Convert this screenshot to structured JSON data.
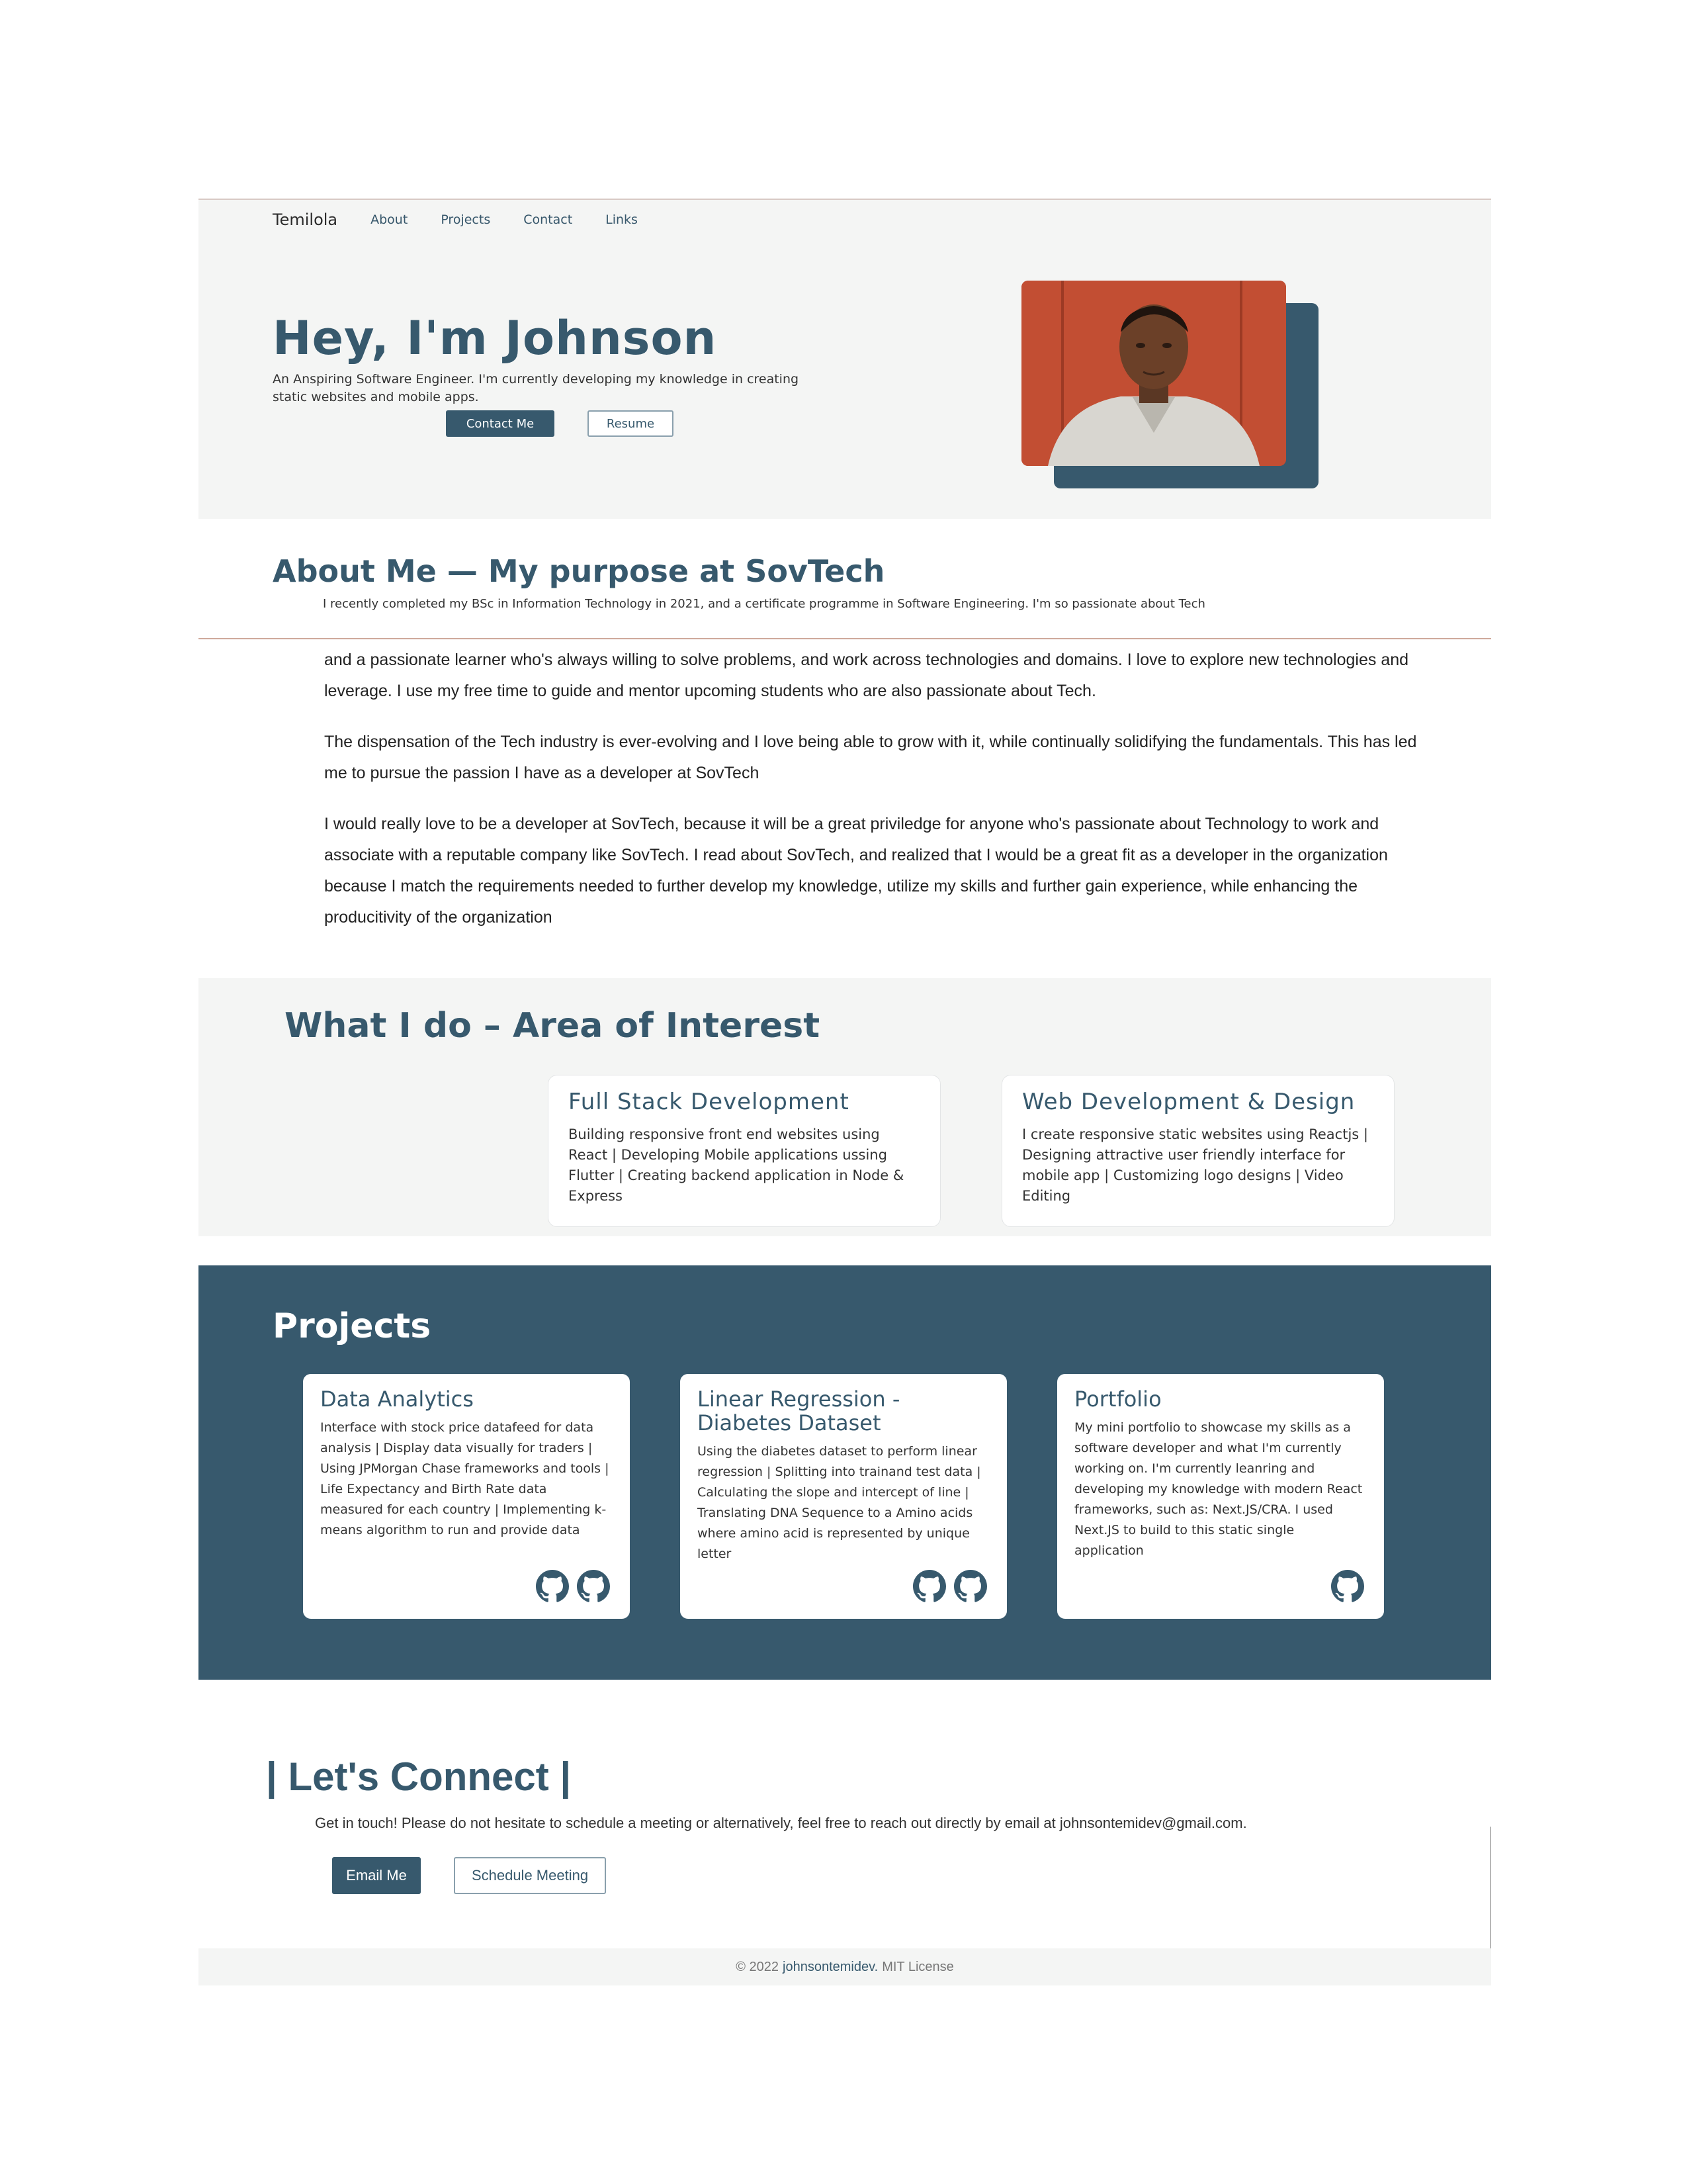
{
  "nav": {
    "brand": "Temilola",
    "links": [
      "About",
      "Projects",
      "Contact",
      "Links"
    ]
  },
  "hero": {
    "title": "Hey, I'm Johnson",
    "tagline": "An Anspiring Software Engineer. I'm currently developing my knowledge in creating static websites and mobile apps.",
    "contact_button": "Contact Me",
    "resume_button": "Resume"
  },
  "about": {
    "title": "About Me — My purpose at SovTech",
    "first_line": "I recently completed my BSc in Information Technology in 2021, and a certificate programme in Software Engineering. I'm so passionate about Tech",
    "paragraphs": [
      "and a passionate learner who's always willing to solve problems, and work across technologies and domains. I love to explore new technologies and leverage. I use my free time to guide and mentor upcoming students who are also passionate about Tech.",
      "The dispensation of the Tech industry is ever-evolving and I love being able to grow with it, while continually solidifying the fundamentals. This has led me to pursue the passion I have as a developer at SovTech",
      "I would really love to be a developer at SovTech, because it will be a great priviledge for anyone who's passionate about Technology to work and associate with a reputable company like SovTech. I read about SovTech, and realized that I would be a great fit as a developer in the organization because I match the requirements needed to further develop my knowledge, utilize my skills and further gain experience, while enhancing the producitivity of the organization"
    ]
  },
  "interest": {
    "title": "What I do – Area of Interest",
    "cards": [
      {
        "title": "Full Stack Development",
        "text": "Building responsive front end websites using React | Developing Mobile applications ussing Flutter | Creating backend application in Node & Express"
      },
      {
        "title": "Web Development & Design",
        "text": "I create responsive static websites using Reactjs | Designing attractive user friendly interface for mobile app | Customizing logo designs | Video Editing"
      }
    ]
  },
  "projects": {
    "title": "Projects",
    "cards": [
      {
        "title": "Data Analytics",
        "text": "Interface with stock price datafeed for data analysis | Display data visually for traders | Using JPMorgan Chase frameworks and tools | Life Expectancy and Birth Rate data measured for each country | Implementing k-means algorithm to run and provide data"
      },
      {
        "title": "Linear Regression - Diabetes Dataset",
        "text": "Using the diabetes dataset to perform linear regression | Splitting into trainand test data | Calculating the slope and intercept of line | Translating DNA Sequence to a Amino acids where amino acid is represented by unique letter"
      },
      {
        "title": "Portfolio",
        "text": "My mini portfolio to showcase my skills as a software developer and what I'm currently working on. I'm currently leanring and developing my knowledge with modern React frameworks, such as: Next.JS/CRA. I used Next.JS to build to this static single application"
      }
    ]
  },
  "connect": {
    "title": "| Let's Connect |",
    "text": "Get in touch! Please do not hesitate to schedule a meeting or alternatively, feel free to reach out directly by email at johnsontemidev@gmail.com.",
    "email_button": "Email Me",
    "schedule_button": "Schedule Meeting"
  },
  "footer": {
    "copyright": "© 2022",
    "owner": "johnsontemidev.",
    "license": "MIT License"
  },
  "icons": {
    "repo_icon": "github-icon"
  },
  "colors": {
    "accent": "#37596d",
    "section_bg": "#f4f5f4"
  }
}
